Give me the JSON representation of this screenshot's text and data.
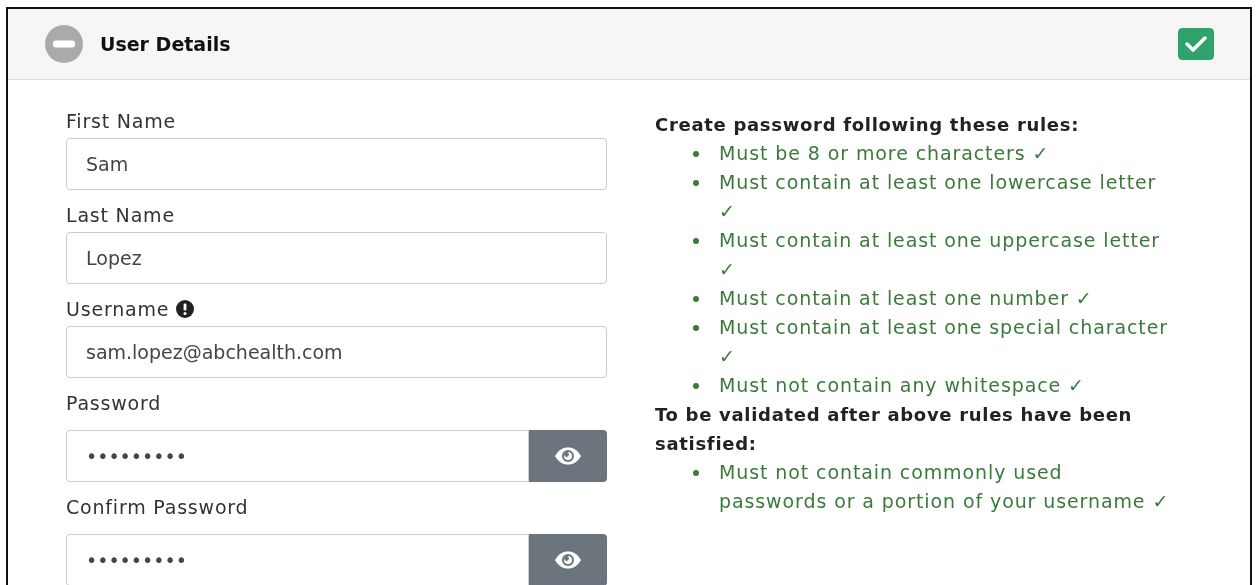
{
  "panel": {
    "title": "User Details",
    "checked": true
  },
  "fields": [
    {
      "label": "First Name",
      "value": "Sam",
      "kind": "text"
    },
    {
      "label": "Last Name",
      "value": "Lopez",
      "kind": "text"
    },
    {
      "label": "Username",
      "value": "sam.lopez@abchealth.com",
      "info": true,
      "kind": "text"
    },
    {
      "label": "Password",
      "value": "•••••••••",
      "kind": "password"
    },
    {
      "label": "Confirm Password",
      "value": "•••••••••",
      "kind": "password"
    }
  ],
  "rule_groups": [
    {
      "heading": "Create password following these rules:",
      "rules": [
        {
          "text": "Must be 8 or more characters ✓",
          "met": true
        },
        {
          "text": "Must contain at least one lowercase letter ✓",
          "met": true
        },
        {
          "text": "Must contain at least one uppercase letter ✓",
          "met": true
        },
        {
          "text": "Must contain at least one number ✓",
          "met": true
        },
        {
          "text": "Must contain at least one special character ✓",
          "met": true
        },
        {
          "text": "Must not contain any whitespace ✓",
          "met": true
        }
      ]
    },
    {
      "heading": "To be validated after above rules have been satisfied:",
      "rules": [
        {
          "text": "Must not contain commonly used passwords or a portion of your username ✓",
          "met": true
        }
      ]
    }
  ]
}
